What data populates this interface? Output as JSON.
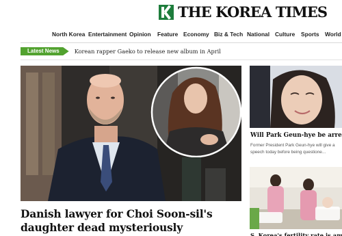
{
  "masthead": {
    "logo_text": "THE KOREA TIMES"
  },
  "nav": {
    "items": [
      "North Korea",
      "Entertainment",
      "Opinion",
      "Feature",
      "Economy",
      "Biz & Tech",
      "National",
      "Culture",
      "Sports",
      "World"
    ]
  },
  "ticker": {
    "tag": "Latest News",
    "headline": "Korean rapper Gaeko to release new album in April"
  },
  "main_story": {
    "headline": "Danish lawyer for Choi Soon-sil's daughter dead mysteriously"
  },
  "side_stories": [
    {
      "title": "Will Park Geun-hye be arrested",
      "description": "Former President Park Geun-hye will give a speech today before being questione..."
    },
    {
      "title": "S. Korea's fertility rate is among"
    }
  ],
  "colors": {
    "brand_green": "#1e7d3c",
    "ticker_green": "#52a22f"
  }
}
